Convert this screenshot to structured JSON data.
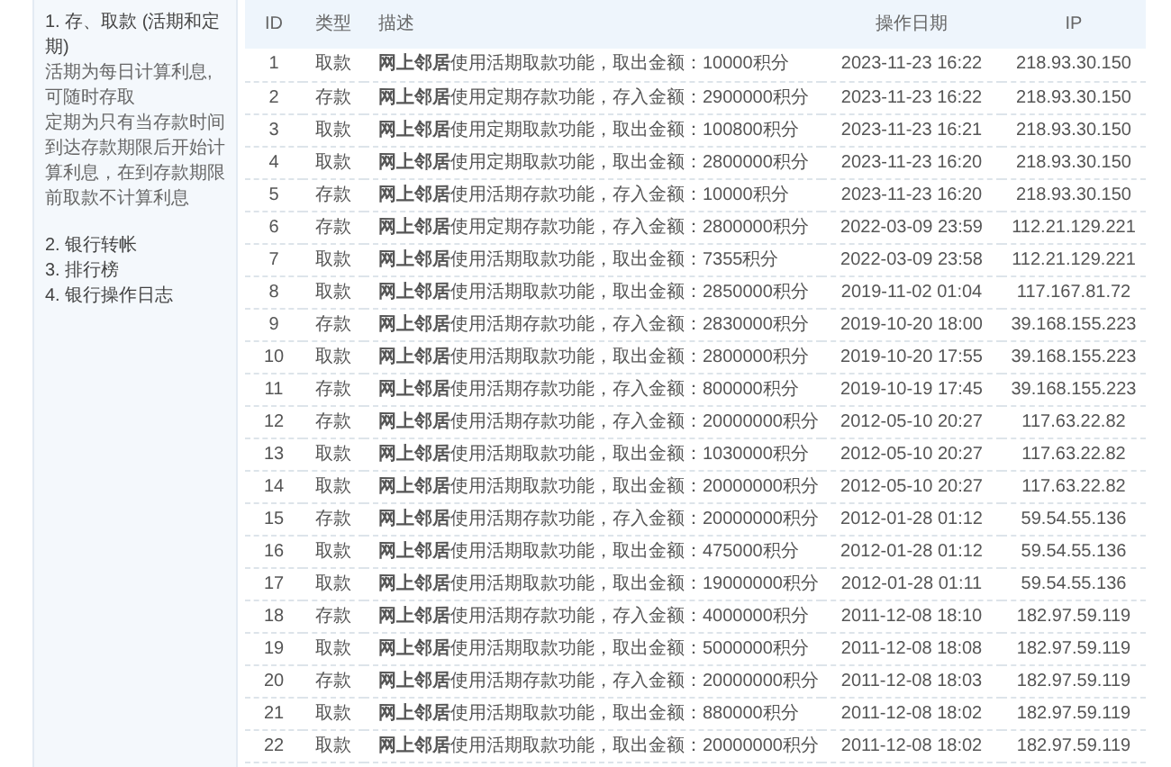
{
  "sidebar": {
    "items": [
      {
        "kind": "title",
        "text": "1. 存、取款 (活期和定期)"
      },
      {
        "kind": "note",
        "text": "活期为每日计算利息,可随时存取"
      },
      {
        "kind": "note",
        "text": "定期为只有当存款时间到达存款期限后开始计算利息，在到存款期限前取款不计算利息"
      },
      {
        "kind": "gap",
        "text": "2. 银行转帐"
      },
      {
        "kind": "title",
        "text": "3. 排行榜"
      },
      {
        "kind": "title",
        "text": "4. 银行操作日志"
      }
    ]
  },
  "table": {
    "columns": [
      "ID",
      "类型",
      "描述",
      "操作日期",
      "IP"
    ],
    "rows": [
      [
        "1",
        "取款",
        "**网上邻居**使用活期取款功能，取出金额：10000积分",
        "2023-11-23 16:22",
        "218.93.30.150"
      ],
      [
        "2",
        "存款",
        "**网上邻居**使用定期存款功能，存入金额：2900000积分",
        "2023-11-23 16:22",
        "218.93.30.150"
      ],
      [
        "3",
        "取款",
        "**网上邻居**使用定期取款功能，取出金额：100800积分",
        "2023-11-23 16:21",
        "218.93.30.150"
      ],
      [
        "4",
        "取款",
        "**网上邻居**使用定期取款功能，取出金额：2800000积分",
        "2023-11-23 16:20",
        "218.93.30.150"
      ],
      [
        "5",
        "存款",
        "**网上邻居**使用活期存款功能，存入金额：10000积分",
        "2023-11-23 16:20",
        "218.93.30.150"
      ],
      [
        "6",
        "存款",
        "**网上邻居**使用定期存款功能，存入金额：2800000积分",
        "2022-03-09 23:59",
        "112.21.129.221"
      ],
      [
        "7",
        "取款",
        "**网上邻居**使用活期取款功能，取出金额：7355积分",
        "2022-03-09 23:58",
        "112.21.129.221"
      ],
      [
        "8",
        "取款",
        "**网上邻居**使用活期取款功能，取出金额：2850000积分",
        "2019-11-02 01:04",
        "117.167.81.72"
      ],
      [
        "9",
        "存款",
        "**网上邻居**使用活期存款功能，存入金额：2830000积分",
        "2019-10-20 18:00",
        "39.168.155.223"
      ],
      [
        "10",
        "取款",
        "**网上邻居**使用活期取款功能，取出金额：2800000积分",
        "2019-10-20 17:55",
        "39.168.155.223"
      ],
      [
        "11",
        "存款",
        "**网上邻居**使用活期存款功能，存入金额：800000积分",
        "2019-10-19 17:45",
        "39.168.155.223"
      ],
      [
        "12",
        "存款",
        "**网上邻居**使用活期存款功能，存入金额：20000000积分",
        "2012-05-10 20:27",
        "117.63.22.82"
      ],
      [
        "13",
        "取款",
        "**网上邻居**使用活期取款功能，取出金额：1030000积分",
        "2012-05-10 20:27",
        "117.63.22.82"
      ],
      [
        "14",
        "取款",
        "**网上邻居**使用活期取款功能，取出金额：20000000积分",
        "2012-05-10 20:27",
        "117.63.22.82"
      ],
      [
        "15",
        "存款",
        "**网上邻居**使用活期存款功能，存入金额：20000000积分",
        "2012-01-28 01:12",
        "59.54.55.136"
      ],
      [
        "16",
        "取款",
        "**网上邻居**使用活期取款功能，取出金额：475000积分",
        "2012-01-28 01:12",
        "59.54.55.136"
      ],
      [
        "17",
        "取款",
        "**网上邻居**使用活期取款功能，取出金额：19000000积分",
        "2012-01-28 01:11",
        "59.54.55.136"
      ],
      [
        "18",
        "存款",
        "**网上邻居**使用活期存款功能，存入金额：4000000积分",
        "2011-12-08 18:10",
        "182.97.59.119"
      ],
      [
        "19",
        "取款",
        "**网上邻居**使用活期取款功能，取出金额：5000000积分",
        "2011-12-08 18:08",
        "182.97.59.119"
      ],
      [
        "20",
        "存款",
        "**网上邻居**使用活期存款功能，存入金额：20000000积分",
        "2011-12-08 18:03",
        "182.97.59.119"
      ],
      [
        "21",
        "取款",
        "**网上邻居**使用活期取款功能，取出金额：880000积分",
        "2011-12-08 18:02",
        "182.97.59.119"
      ],
      [
        "22",
        "取款",
        "**网上邻居**使用活期取款功能，取出金额：20000000积分",
        "2011-12-08 18:02",
        "182.97.59.119"
      ]
    ]
  }
}
